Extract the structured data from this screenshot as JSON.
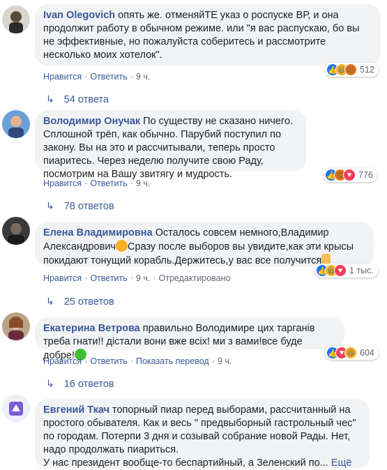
{
  "comments": [
    {
      "author": "Ivan Olegovich",
      "text": "опять же. отменяйТЕ указ о роспуске ВР, и она продолжит работу в обычном режиме. или \"я вас распускаю, бо вы не эффективные, но пожалуйста соберитесь и рассмотрите несколько моих хотелок\".",
      "like": "Нравится",
      "reply": "Ответить",
      "time": "9 ч.",
      "reaction_count": "512",
      "reactions": [
        "like-icon",
        "haha-icon",
        "angry-icon"
      ],
      "replies": "54 ответа"
    },
    {
      "author": "Володимир Онучак",
      "text": "По существу не сказано ничего. Сплошной трёп, как обычно. Парубий поступил по закону. Вы на это и рассчитывали, теперь просто пиаритесь. Через неделю получите свою Раду, посмотрим на Вашу звитягу и мудрость.",
      "like": "Нравится",
      "reply": "Ответить",
      "time": "9 ч.",
      "reaction_count": "776",
      "reactions": [
        "like-icon",
        "angry-icon",
        "love-icon"
      ],
      "replies": "78 ответов"
    },
    {
      "author": "Елена Владимировна",
      "text_a": "Осталось совсем немного,Владимир Александрович",
      "text_b": "Сразу после выборов вы увидите,как эти крысы покидают тонущий корабль.Держитесь,у вас все получится",
      "like": "Нравится",
      "reply": "Ответить",
      "time": "9 ч.",
      "edited": "Отредактировано",
      "reaction_count": "1 тыс.",
      "reactions": [
        "like-icon",
        "haha-icon",
        "love-icon"
      ],
      "replies": "25 ответов"
    },
    {
      "author": "Екатерина Ветрова",
      "text": "правильно Володимире цих тарганів треба гнати!! дістали вони вже всіх! ми з вами!все буде добре!",
      "like": "Нравится",
      "reply": "Ответить",
      "translate": "Показать перевод",
      "time": "9 ч.",
      "reaction_count": "604",
      "reactions": [
        "like-icon",
        "love-icon",
        "haha-icon"
      ],
      "replies": "16 ответов"
    },
    {
      "author": "Евгений Ткач",
      "text": "топорный пиар перед выборами, рассчитанный на простого обывателя. Как и весь \" предвыборный гастрольный чес\" по городам. Потерпи 3 дня и созывай собрание новой Рады. Нет, надо продолжать пиариться.",
      "text_b": "У нас президент вообще-то беспартийный, а Зеленский по...",
      "more": "Ещё"
    }
  ],
  "colors": {
    "link": "#385898",
    "bubble": "#f2f3f5",
    "meta": "#606770",
    "like": "#1877f2",
    "love": "#f33e58",
    "angry": "#e9710f",
    "haha": "#f7b125"
  }
}
